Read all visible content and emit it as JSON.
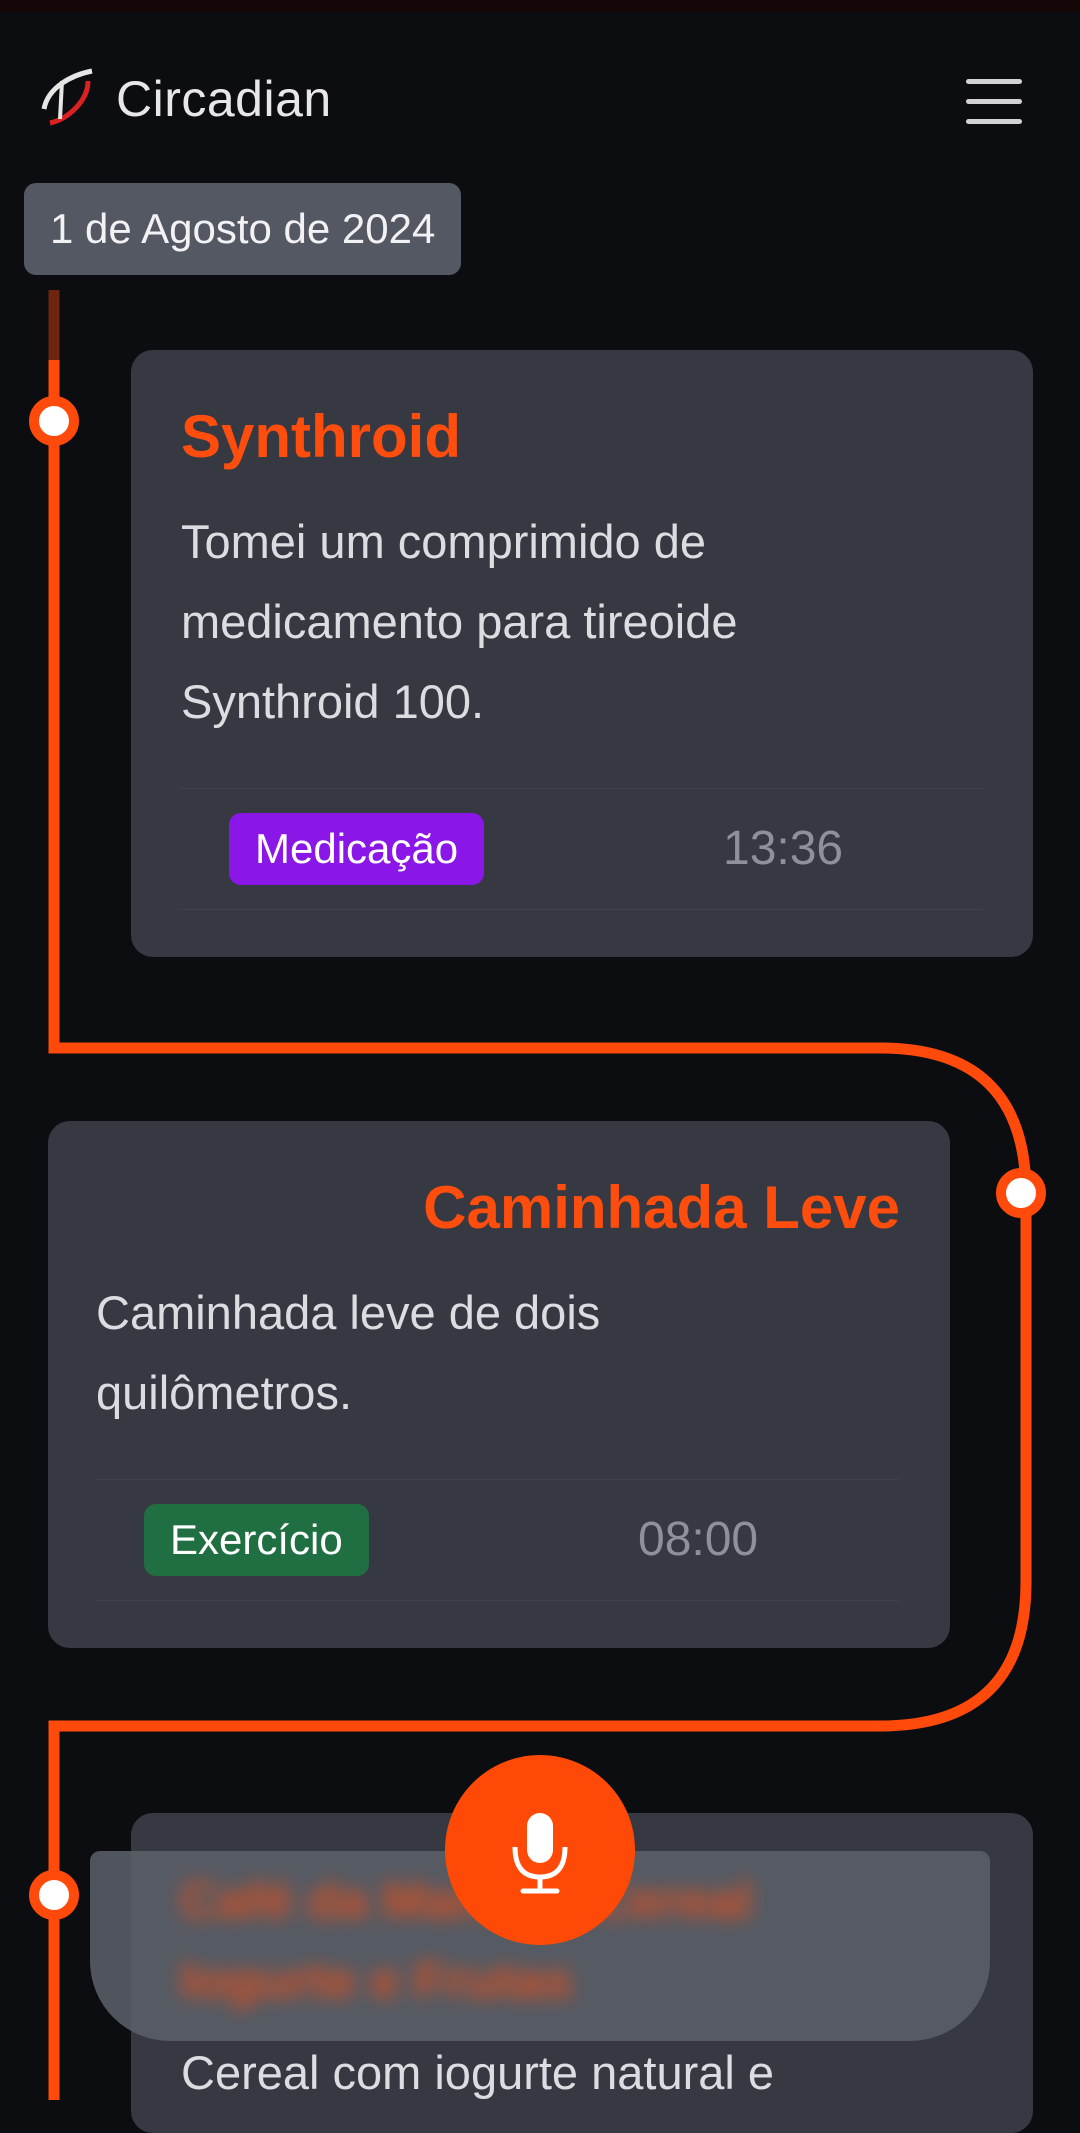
{
  "app": {
    "title": "Circadian"
  },
  "header": {
    "menu_icon": "hamburger-icon"
  },
  "date_label": "1 de Agosto de 2024",
  "colors": {
    "accent": "#ff4a0c",
    "card_bg": "#363941",
    "tag_medication": "#8a17e8",
    "tag_exercise": "#1f6f43",
    "background": "#0c0d10"
  },
  "entries": [
    {
      "title": "Synthroid",
      "text_line1": "Tomei um comprimido de",
      "text_line2": "medicamento para tireoide",
      "text_line3": "Synthroid 100.",
      "tag": "Medicação",
      "time": "13:36"
    },
    {
      "title": "Caminhada Leve",
      "text_line1": "Caminhada leve de dois",
      "text_line2": "quilômetros.",
      "tag": "Exercício",
      "time": "08:00"
    },
    {
      "title_blurred": "Café da Manhã · Cereal",
      "title_blurred_line2": "Iogurte e Frutas",
      "text_line1": "Cereal com iogurte natural e"
    }
  ],
  "mic": {
    "icon": "microphone-icon"
  }
}
